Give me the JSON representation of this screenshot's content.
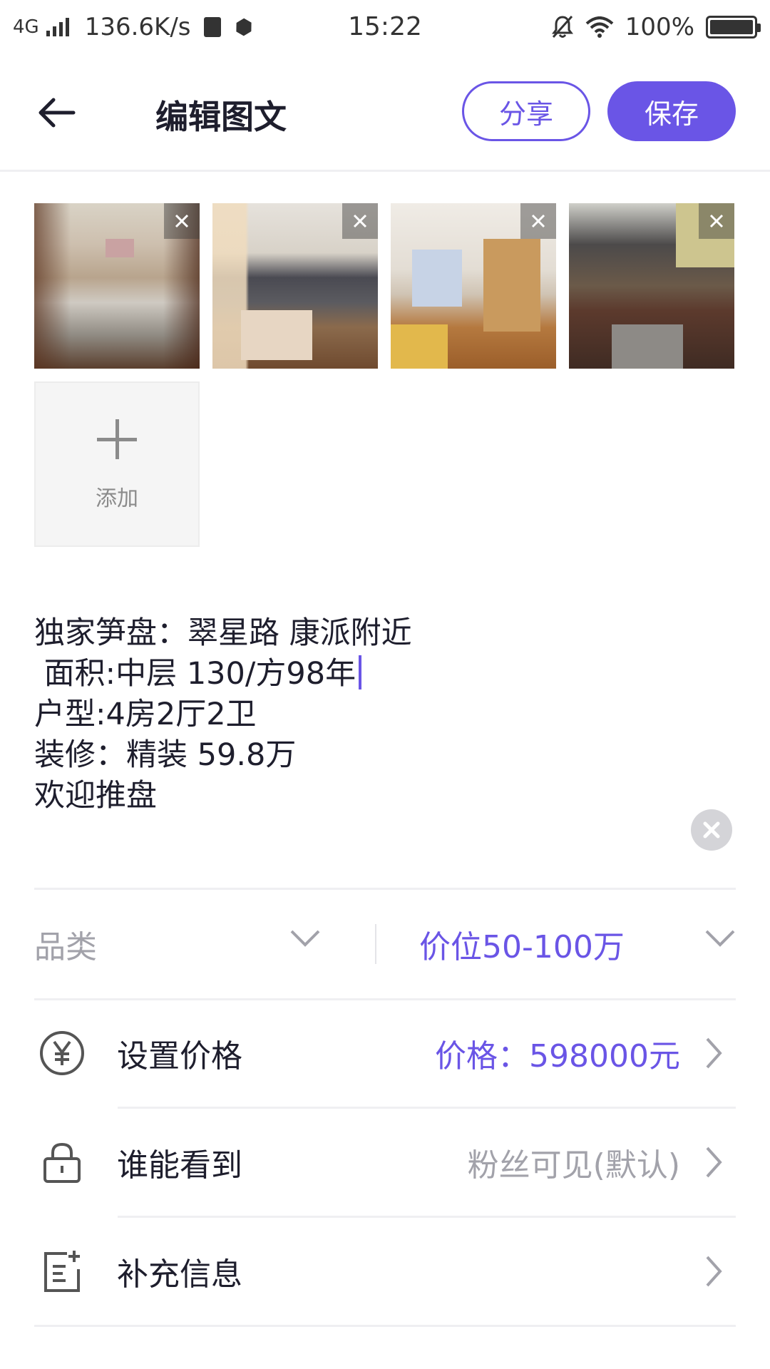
{
  "status_bar": {
    "network": "4G",
    "speed": "136.6K/s",
    "time": "15:22",
    "battery": "100%",
    "battery_level": 1.0
  },
  "header": {
    "title": "编辑图文",
    "share_label": "分享",
    "save_label": "保存"
  },
  "photos": {
    "items": [
      {
        "name": "photo-living-room"
      },
      {
        "name": "photo-bedroom"
      },
      {
        "name": "photo-kids-room"
      },
      {
        "name": "photo-kitchen"
      }
    ],
    "add_label": "添加"
  },
  "description": {
    "lines": [
      "独家笋盘：翠星路 康派附近",
      " 面积:中层 130/方98年",
      "户型:4房2厅2卫",
      "装修：精装 59.8万",
      "欢迎推盘"
    ]
  },
  "filters": {
    "category_placeholder": "品类",
    "price_range": "价位50-100万"
  },
  "settings": {
    "price": {
      "label": "设置价格",
      "value": "价格：598000元",
      "icon": "yuan-icon"
    },
    "visibility": {
      "label": "谁能看到",
      "value": "粉丝可见(默认)",
      "icon": "lock-icon"
    },
    "extra_info": {
      "label": "补充信息",
      "icon": "note-add-icon"
    }
  },
  "colors": {
    "accent": "#6a55e6",
    "text": "#1e1e2d",
    "muted": "#a2a2aa"
  }
}
